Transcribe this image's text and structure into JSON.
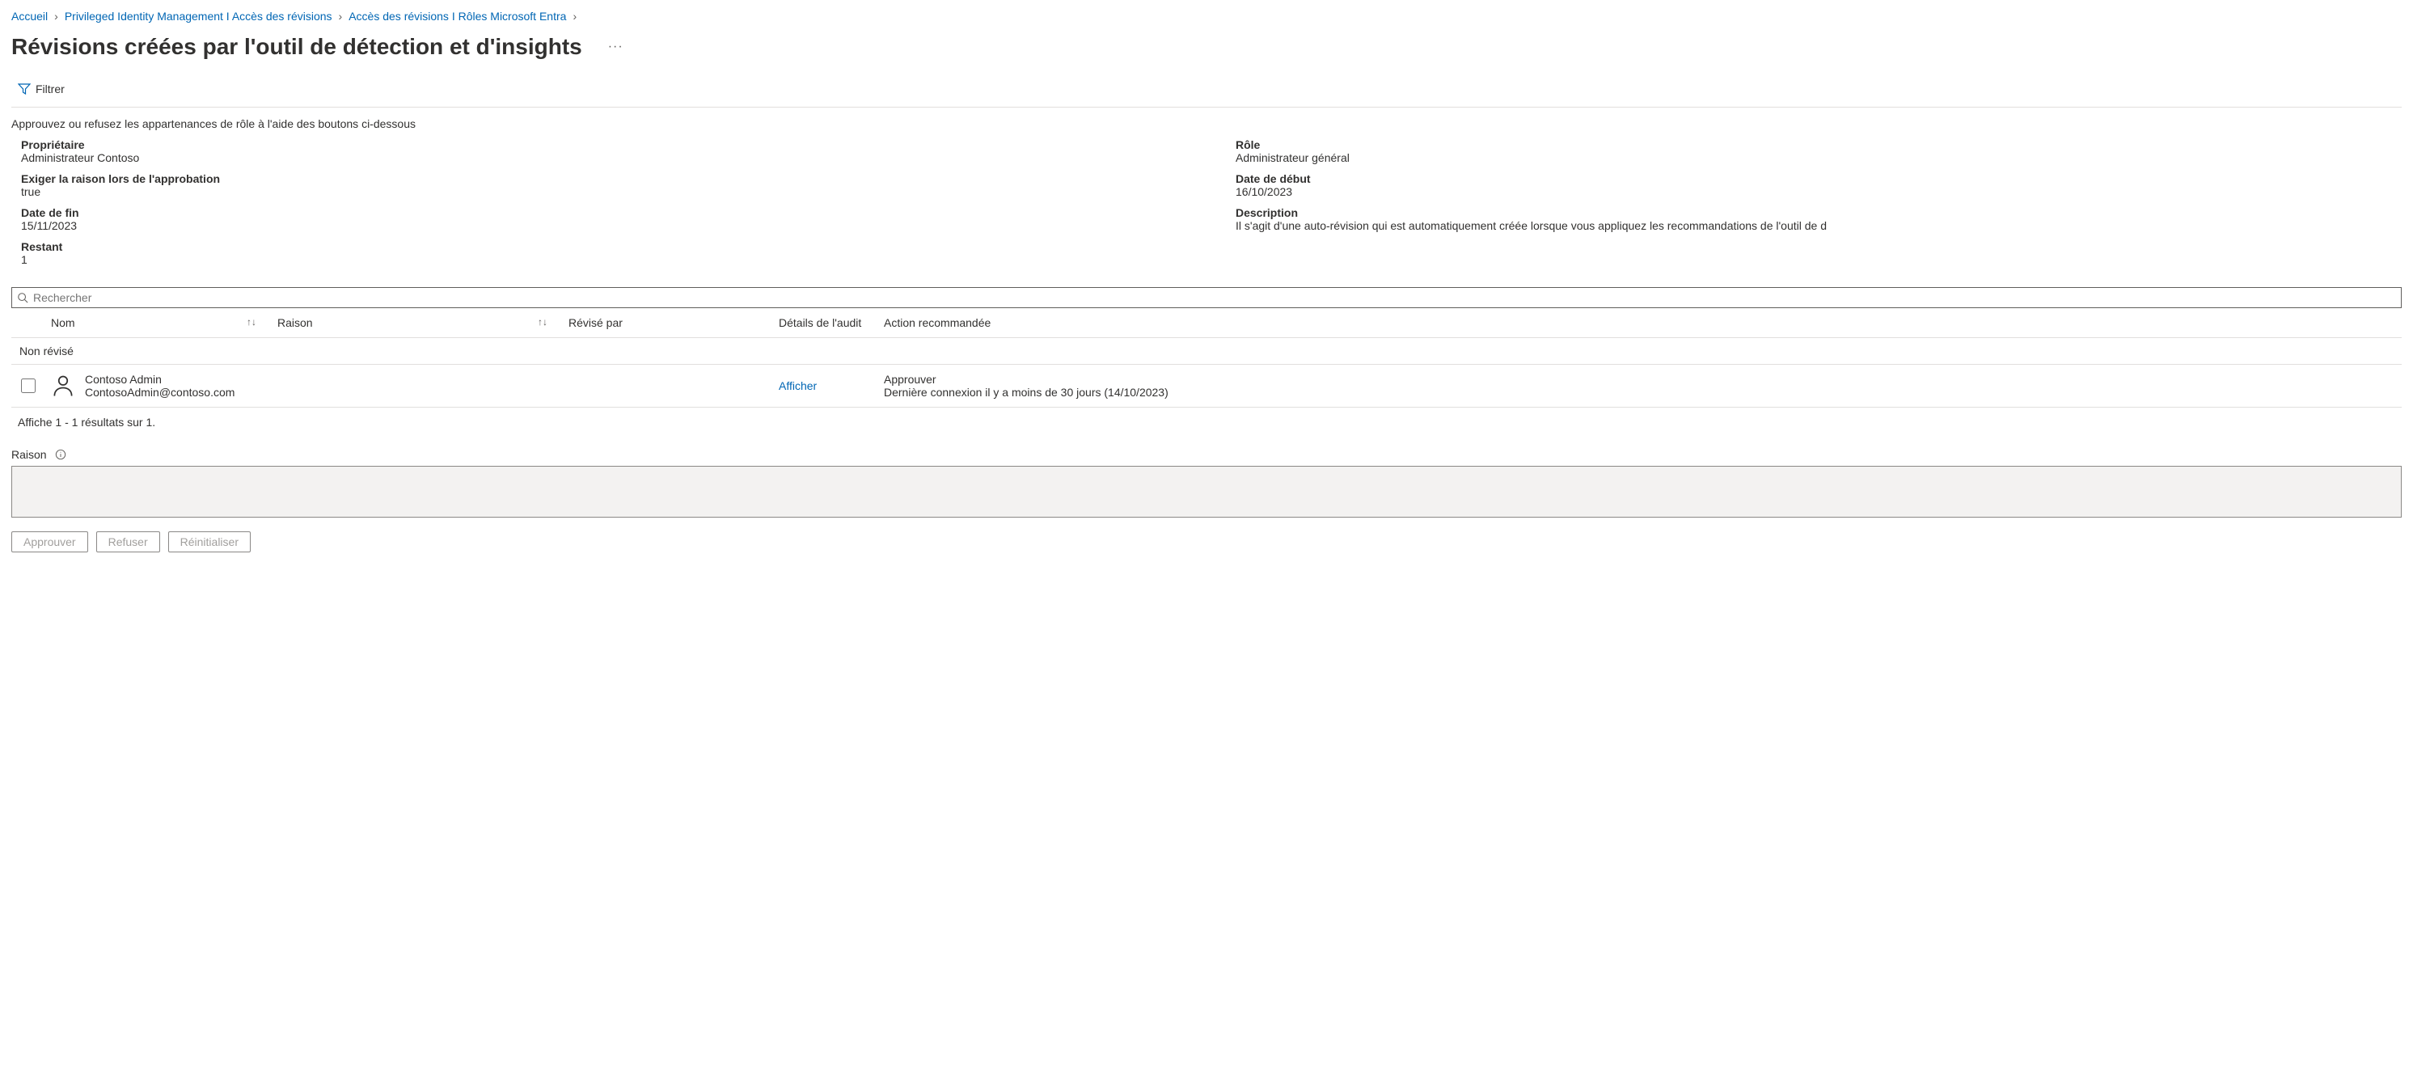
{
  "breadcrumb": {
    "items": [
      {
        "label": "Accueil"
      },
      {
        "label": "Privileged Identity Management I Accès des révisions"
      },
      {
        "label": "Accès des révisions I Rôles Microsoft Entra"
      }
    ]
  },
  "page_title": "Révisions créées par l'outil de détection et d'insights",
  "toolbar": {
    "filter": "Filtrer"
  },
  "instruction": "Approuvez ou refusez les appartenances de rôle à l'aide des boutons ci-dessous",
  "details": {
    "owner_label": "Propriétaire",
    "owner_value": "Administrateur Contoso",
    "role_label": "Rôle",
    "role_value": "Administrateur général",
    "require_reason_label": "Exiger la raison lors de l'approbation",
    "require_reason_value": "true",
    "start_label": "Date de début",
    "start_value": "16/10/2023",
    "end_label": "Date de fin",
    "end_value": "15/11/2023",
    "description_label": "Description",
    "description_value": "Il s'agit d'une auto-révision qui est automatiquement créée lorsque vous appliquez les recommandations de l'outil de d",
    "remaining_label": "Restant",
    "remaining_value": "1"
  },
  "search": {
    "placeholder": "Rechercher"
  },
  "table": {
    "headers": {
      "name": "Nom",
      "reason": "Raison",
      "reviewed_by": "Révisé par",
      "audit_details": "Détails de l'audit",
      "recommended_action": "Action recommandée"
    },
    "group_label": "Non révisé",
    "rows": [
      {
        "display_name": "Contoso Admin",
        "email": "ContosoAdmin@contoso.com",
        "reason": "",
        "reviewed_by": "",
        "audit_link": "Afficher",
        "rec_action": "Approuver",
        "rec_detail": "Dernière connexion il y a moins de 30 jours (14/10/2023)"
      }
    ],
    "results_count": "Affiche 1 - 1 résultats sur 1."
  },
  "reason_section": {
    "label": "Raison"
  },
  "buttons": {
    "approve": "Approuver",
    "deny": "Refuser",
    "reset": "Réinitialiser"
  }
}
